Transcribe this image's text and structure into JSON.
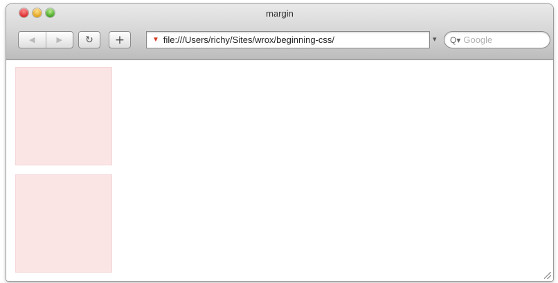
{
  "window": {
    "title": "margin"
  },
  "toolbar": {
    "back_icon": "back-arrow-icon",
    "forward_icon": "forward-arrow-icon",
    "reload_icon": "reload-icon",
    "add_icon": "plus-icon",
    "url": "file:///Users/richy/Sites/wrox/beginning-css/",
    "search_placeholder": "Google"
  },
  "content": {
    "box_color": "#fbe4e4",
    "boxes": [
      "pink-box",
      "pink-box"
    ]
  }
}
